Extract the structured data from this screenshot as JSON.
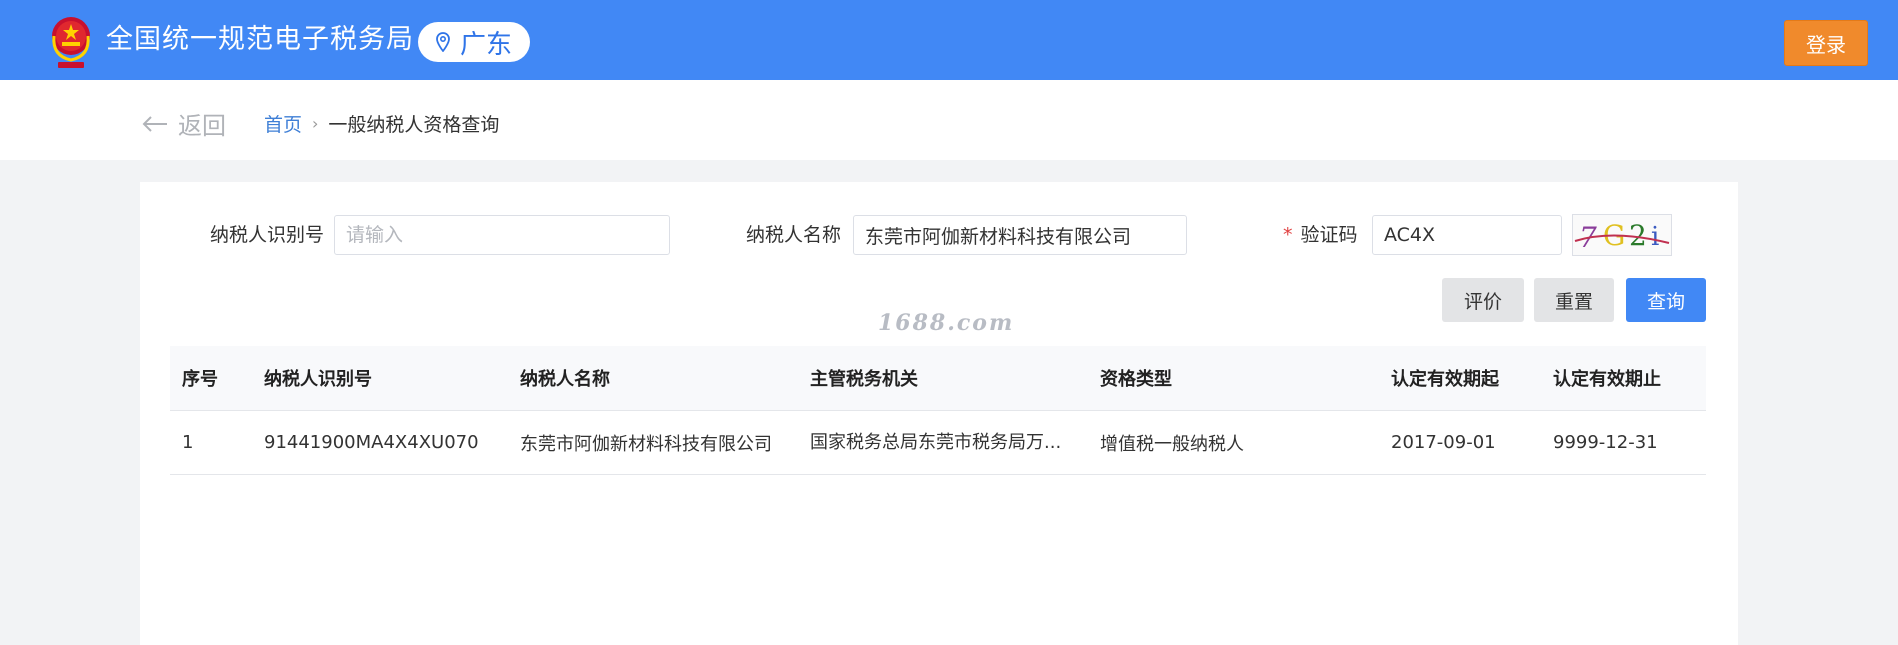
{
  "header": {
    "site_title": "全国统一规范电子税务局",
    "region": "广东",
    "login_label": "登录",
    "brand_color": "#4188f5"
  },
  "breadcrumb": {
    "back_label": "返回",
    "home": "首页",
    "separator": "›",
    "current": "一般纳税人资格查询"
  },
  "form": {
    "taxpayer_id_label": "纳税人识别号",
    "taxpayer_id_placeholder": "请输入",
    "taxpayer_id_value": "",
    "taxpayer_name_label": "纳税人名称",
    "taxpayer_name_value": "东莞市阿伽新材料科技有限公司",
    "captcha_required_mark": "*",
    "captcha_label": "验证码",
    "captcha_value": "AC4X",
    "captcha_image_text": "7G2i"
  },
  "buttons": {
    "evaluate": "评价",
    "reset": "重置",
    "query": "查询"
  },
  "watermark": "1688.com",
  "table": {
    "headers": [
      "序号",
      "纳税人识别号",
      "纳税人名称",
      "主管税务机关",
      "资格类型",
      "认定有效期起",
      "认定有效期止"
    ],
    "rows": [
      [
        "1",
        "91441900MA4X4XU070",
        "东莞市阿伽新材料科技有限公司",
        "国家税务总局东莞市税务局万...",
        "增值税一般纳税人",
        "2017-09-01",
        "9999-12-31"
      ]
    ]
  }
}
